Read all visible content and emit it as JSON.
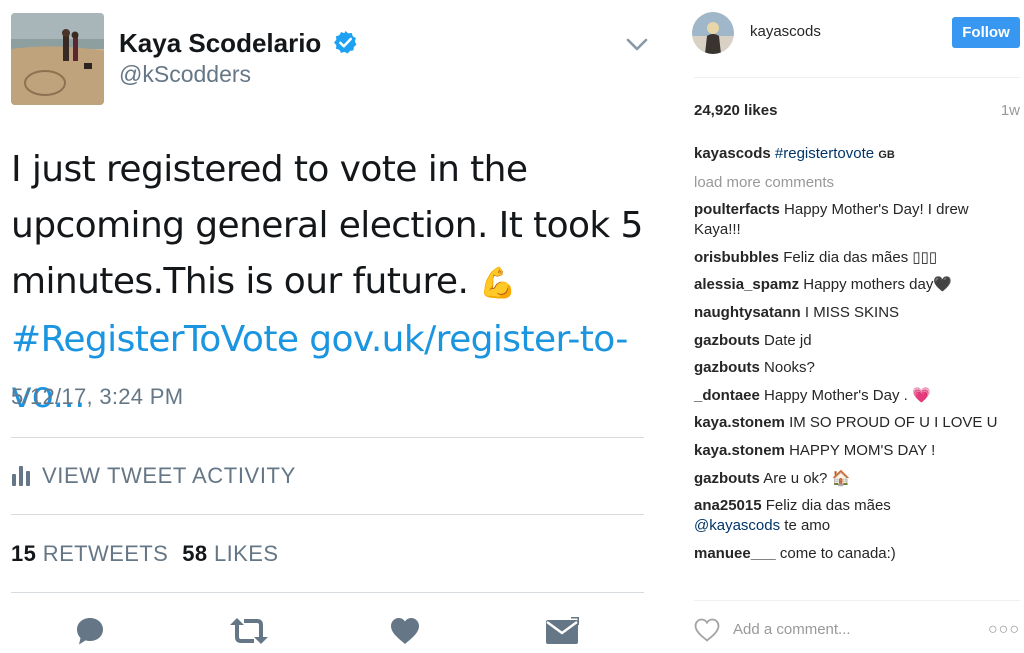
{
  "tweet": {
    "display_name": "Kaya Scodelario",
    "handle": "@kScodders",
    "text_plain": "I just registered to vote in the upcoming general election. It took 5 minutes.This is our future. ",
    "emoji": "💪",
    "hashtag": "#RegisterToVote",
    "link": "gov.uk/register-to-vo...",
    "timestamp": "5/12/17, 3:24 PM",
    "activity_label": "VIEW TWEET ACTIVITY",
    "retweets_count": "15",
    "retweets_label": "RETWEETS",
    "likes_count": "58",
    "likes_label": "LIKES",
    "link_color": "#1b95e0",
    "icons": [
      "verified-badge-icon",
      "caret-down-icon",
      "bar-chart-icon",
      "reply-icon",
      "retweet-icon",
      "heart-icon",
      "direct-message-icon"
    ]
  },
  "instagram": {
    "username": "kayascods",
    "follow_label": "Follow",
    "likes": "24,920 likes",
    "age": "1w",
    "caption": {
      "user": "kayascods",
      "text": "#registertovote",
      "flag": "GB"
    },
    "load_more": "load more comments",
    "comments": [
      {
        "user": "poulterfacts",
        "text": "Happy Mother's Day! I drew Kaya!!!"
      },
      {
        "user": "orisbubbles",
        "text": "Feliz dia das mães ▯▯▯"
      },
      {
        "user": "alessia_spamz",
        "text": "Happy mothers day🖤"
      },
      {
        "user": "naughtysatann",
        "text": "I MISS SKINS"
      },
      {
        "user": "gazbouts",
        "text": "Date jd"
      },
      {
        "user": "gazbouts",
        "text": "Nooks?"
      },
      {
        "user": "_dontaee",
        "text": "Happy Mother's Day . 💗"
      },
      {
        "user": "kaya.stonem",
        "text": "IM SO PROUD OF U I LOVE U"
      },
      {
        "user": "kaya.stonem",
        "text": "HAPPY MOM'S DAY !"
      },
      {
        "user": "gazbouts",
        "text": "Are u ok? 🏠"
      },
      {
        "user": "ana25015",
        "text": "Feliz dia das mães",
        "mention": "@kayascods",
        "text_after": " te amo"
      },
      {
        "user": "manuee___",
        "text": "come to canada:)"
      }
    ],
    "add_comment_placeholder": "Add a comment...",
    "more": "○○○",
    "follow_color": "#3897f0",
    "icons": [
      "heart-outline-icon",
      "more-options-icon"
    ]
  }
}
